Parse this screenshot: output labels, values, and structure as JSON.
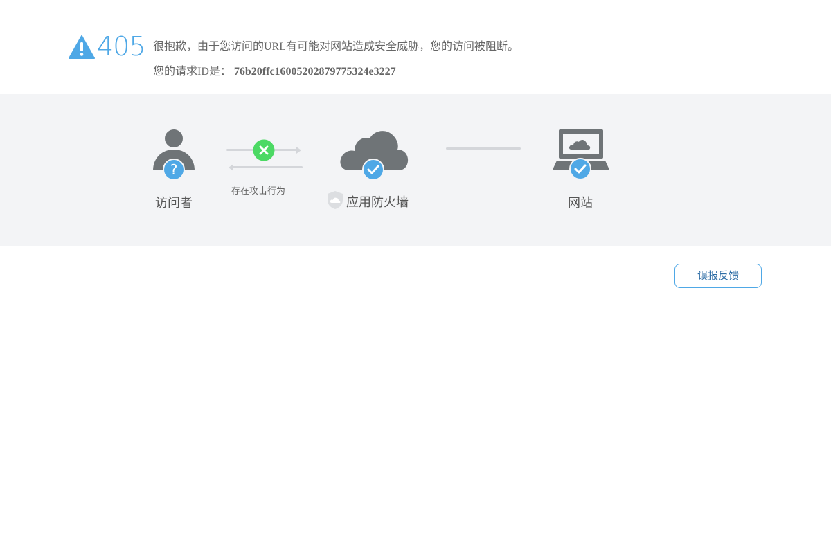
{
  "error": {
    "code": "405",
    "message": "很抱歉，由于您访问的URL有可能对网站造成安全威胁，您的访问被阻断。",
    "request_id_label": "您的请求ID是：",
    "request_id": "76b20ffc16005202879775324e3227"
  },
  "flow": {
    "visitor_label": "访问者",
    "attack_label": "存在攻击行为",
    "firewall_label": "应用防火墙",
    "website_label": "网站"
  },
  "actions": {
    "feedback_label": "误报反馈"
  },
  "colors": {
    "accent_blue": "#4fa8e6",
    "success_green": "#4cd964",
    "icon_gray": "#6f7477",
    "band_bg": "#f3f4f6"
  }
}
